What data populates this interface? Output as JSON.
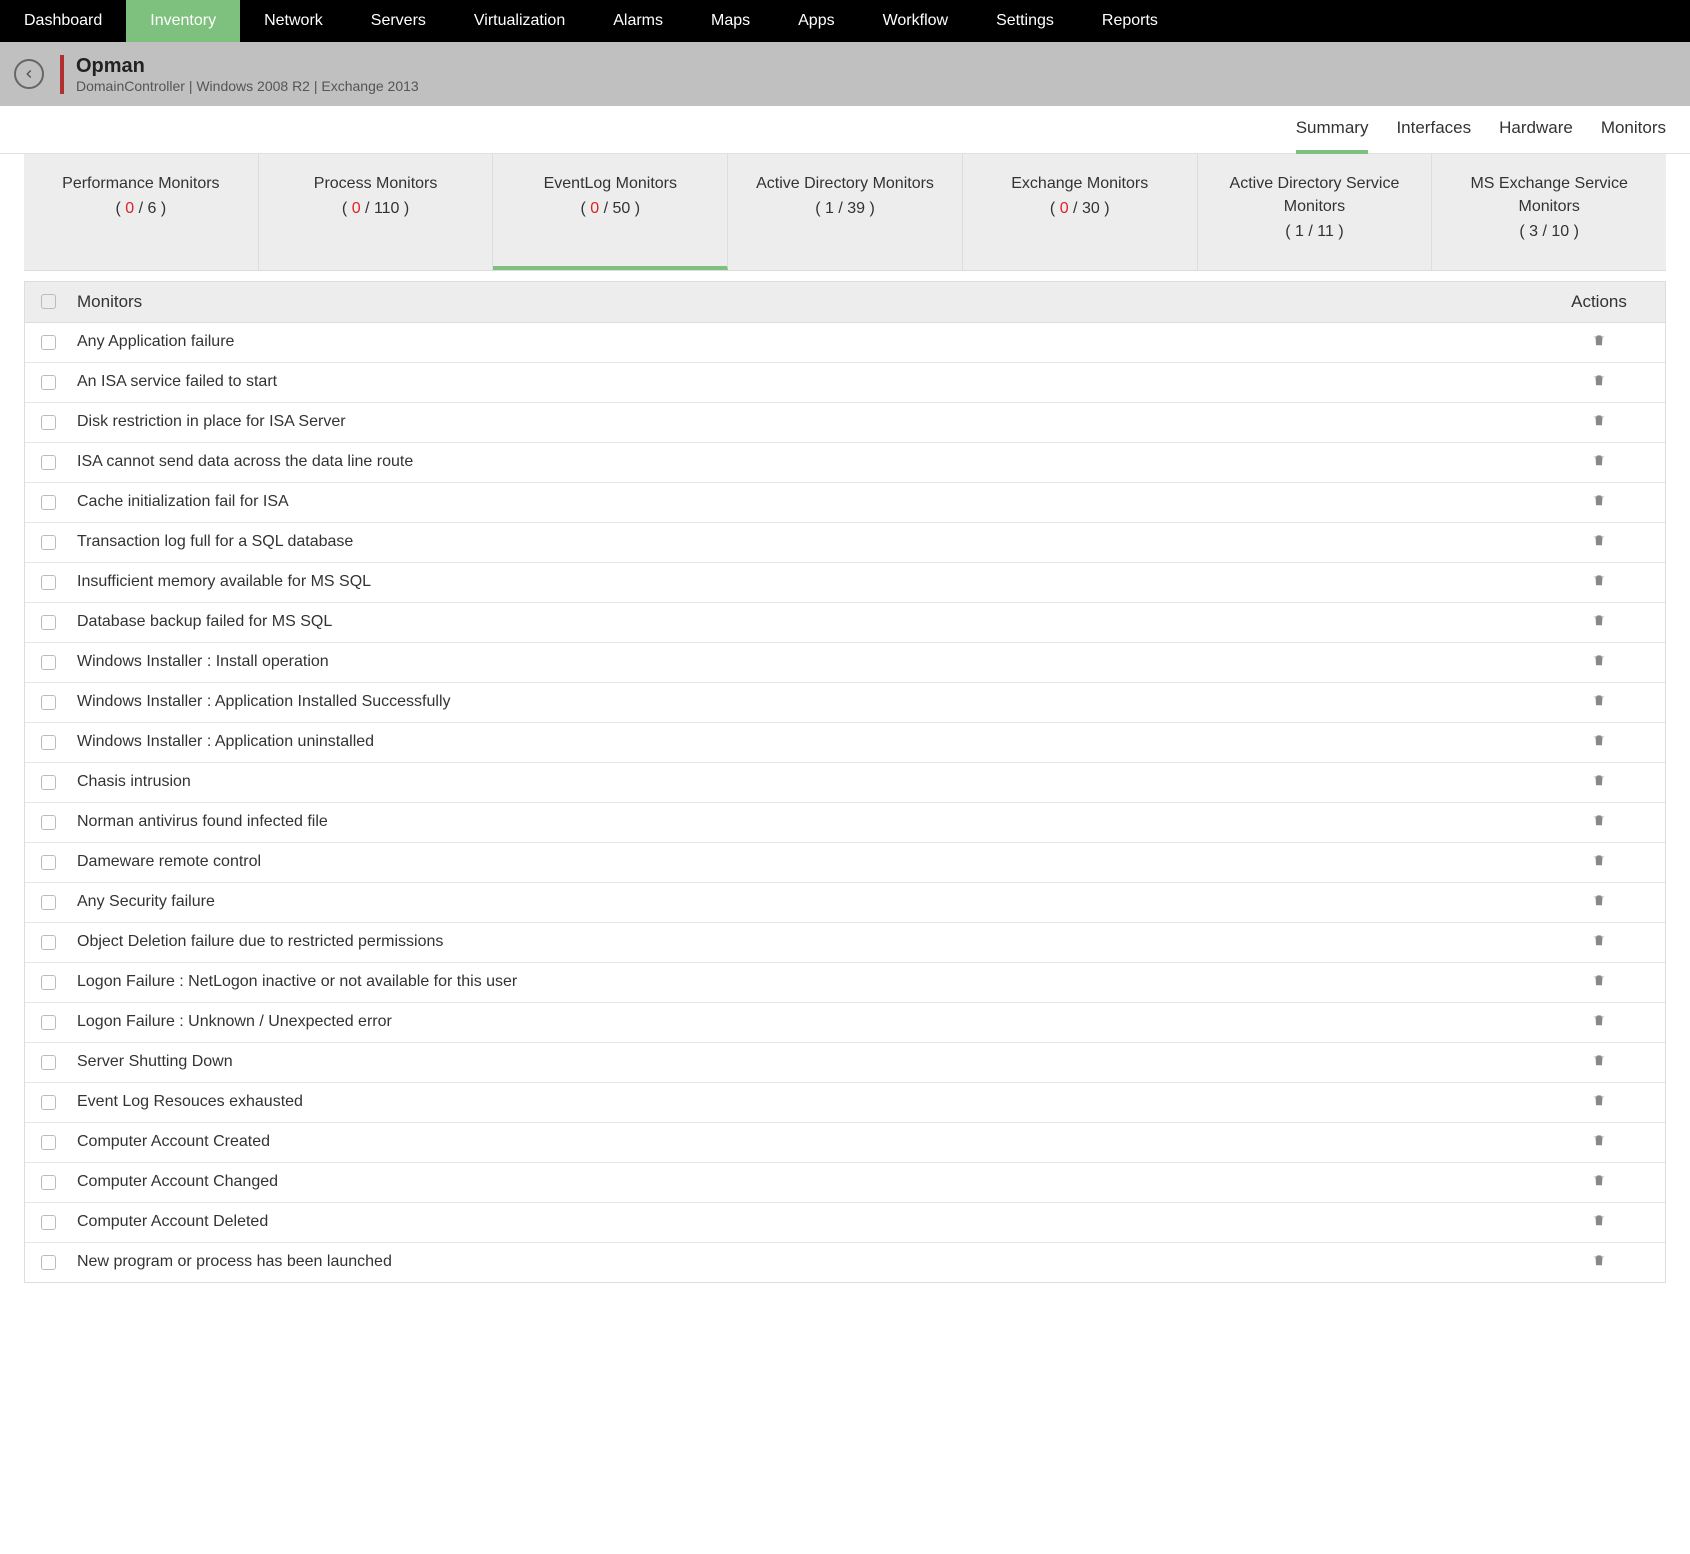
{
  "topnav": {
    "items": [
      {
        "label": "Dashboard",
        "active": false
      },
      {
        "label": "Inventory",
        "active": true
      },
      {
        "label": "Network",
        "active": false
      },
      {
        "label": "Servers",
        "active": false
      },
      {
        "label": "Virtualization",
        "active": false
      },
      {
        "label": "Alarms",
        "active": false
      },
      {
        "label": "Maps",
        "active": false
      },
      {
        "label": "Apps",
        "active": false
      },
      {
        "label": "Workflow",
        "active": false
      },
      {
        "label": "Settings",
        "active": false
      },
      {
        "label": "Reports",
        "active": false
      }
    ]
  },
  "header": {
    "title": "Opman",
    "subtitle": "DomainController | Windows 2008 R2   |   Exchange 2013"
  },
  "subtabs": {
    "items": [
      {
        "label": "Summary",
        "active": true
      },
      {
        "label": "Interfaces",
        "active": false
      },
      {
        "label": "Hardware",
        "active": false
      },
      {
        "label": "Monitors",
        "active": false
      }
    ]
  },
  "monitortabs": {
    "items": [
      {
        "title": "Performance Monitors",
        "cur": "0",
        "total": "6",
        "curRed": true,
        "active": false
      },
      {
        "title": "Process Monitors",
        "cur": "0",
        "total": "110",
        "curRed": true,
        "active": false
      },
      {
        "title": "EventLog Monitors",
        "cur": "0",
        "total": "50",
        "curRed": true,
        "active": true
      },
      {
        "title": "Active Directory Monitors",
        "cur": "1",
        "total": "39",
        "curRed": false,
        "active": false
      },
      {
        "title": "Exchange Monitors",
        "cur": "0",
        "total": "30",
        "curRed": true,
        "active": false
      },
      {
        "title": "Active Directory Service Monitors",
        "cur": "1",
        "total": "11",
        "curRed": false,
        "active": false
      },
      {
        "title": "MS Exchange Service Monitors",
        "cur": "3",
        "total": "10",
        "curRed": false,
        "active": false
      }
    ]
  },
  "table": {
    "headers": {
      "name": "Monitors",
      "actions": "Actions"
    },
    "rows": [
      {
        "name": "Any Application failure"
      },
      {
        "name": "An ISA service failed to start"
      },
      {
        "name": "Disk restriction in place for ISA Server"
      },
      {
        "name": "ISA cannot send data across the data line route"
      },
      {
        "name": "Cache initialization fail for ISA"
      },
      {
        "name": "Transaction log full for a SQL database"
      },
      {
        "name": "Insufficient memory available for MS SQL"
      },
      {
        "name": "Database backup failed for MS SQL"
      },
      {
        "name": "Windows Installer : Install operation"
      },
      {
        "name": "Windows Installer : Application Installed Successfully"
      },
      {
        "name": "Windows Installer : Application uninstalled"
      },
      {
        "name": "Chasis intrusion"
      },
      {
        "name": "Norman antivirus found infected file"
      },
      {
        "name": "Dameware remote control"
      },
      {
        "name": "Any Security failure"
      },
      {
        "name": "Object Deletion failure due to restricted permissions"
      },
      {
        "name": "Logon Failure : NetLogon inactive or not available for this user"
      },
      {
        "name": "Logon Failure : Unknown / Unexpected error"
      },
      {
        "name": "Server Shutting Down"
      },
      {
        "name": "Event Log Resouces exhausted"
      },
      {
        "name": "Computer Account Created"
      },
      {
        "name": "Computer Account Changed"
      },
      {
        "name": "Computer Account Deleted"
      },
      {
        "name": "New program or process has been launched"
      }
    ]
  }
}
